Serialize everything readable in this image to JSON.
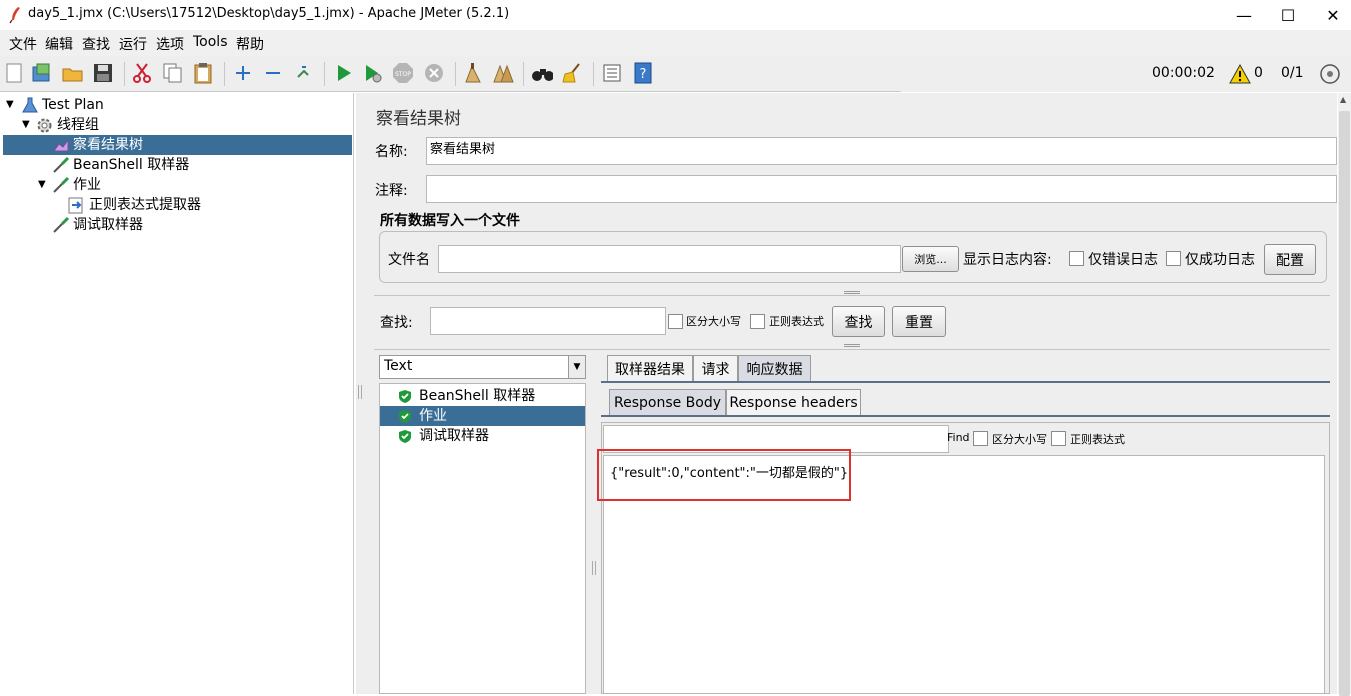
{
  "window": {
    "title": "day5_1.jmx (C:\\Users\\17512\\Desktop\\day5_1.jmx) - Apache JMeter (5.2.1)",
    "minimize": "—",
    "maximize": "☐",
    "close": "✕"
  },
  "menu": [
    "文件",
    "编辑",
    "查找",
    "运行",
    "选项",
    "Tools",
    "帮助"
  ],
  "toolbar": {
    "timer": "00:00:02",
    "warnings": "0",
    "threads": "0/1"
  },
  "tree": {
    "items": [
      {
        "label": "Test Plan",
        "icon": "flask-icon"
      },
      {
        "label": "线程组",
        "icon": "gear-icon"
      },
      {
        "label": "察看结果树",
        "icon": "chart-icon",
        "selected": true
      },
      {
        "label": "BeanShell 取样器",
        "icon": "pipette-icon"
      },
      {
        "label": "作业",
        "icon": "pipette-icon"
      },
      {
        "label": "正则表达式提取器",
        "icon": "arrow-doc-icon"
      },
      {
        "label": "调试取样器",
        "icon": "pipette-icon"
      }
    ]
  },
  "panel": {
    "heading": "察看结果树",
    "name_label": "名称:",
    "name_value": "察看结果树",
    "comment_label": "注释:",
    "comment_value": "",
    "file_section_title": "所有数据写入一个文件",
    "filename_label": "文件名",
    "filename_value": "",
    "browse_label": "浏览...",
    "log_content_label": "显示日志内容:",
    "errors_only_label": "仅错误日志",
    "success_only_label": "仅成功日志",
    "config_label": "配置",
    "search_label": "查找:",
    "search_value": "",
    "case_sensitive_label": "区分大小写",
    "regex_label": "正则表达式",
    "find_button": "查找",
    "reset_button": "重置"
  },
  "results": {
    "renderer": "Text",
    "samples": [
      {
        "label": "BeanShell 取样器",
        "status": "success"
      },
      {
        "label": "作业",
        "status": "success",
        "selected": true
      },
      {
        "label": "调试取样器",
        "status": "success"
      }
    ],
    "tabs": [
      "取样器结果",
      "请求",
      "响应数据"
    ],
    "active_tab": "响应数据",
    "subtabs": [
      "Response Body",
      "Response headers"
    ],
    "active_subtab": "Response Body",
    "find_label": "Find",
    "find_case_label": "区分大小写",
    "find_regex_label": "正则表达式",
    "response_body": "{\"result\":0,\"content\":\"一切都是假的\"}",
    "highlight_color": "#e03030"
  }
}
